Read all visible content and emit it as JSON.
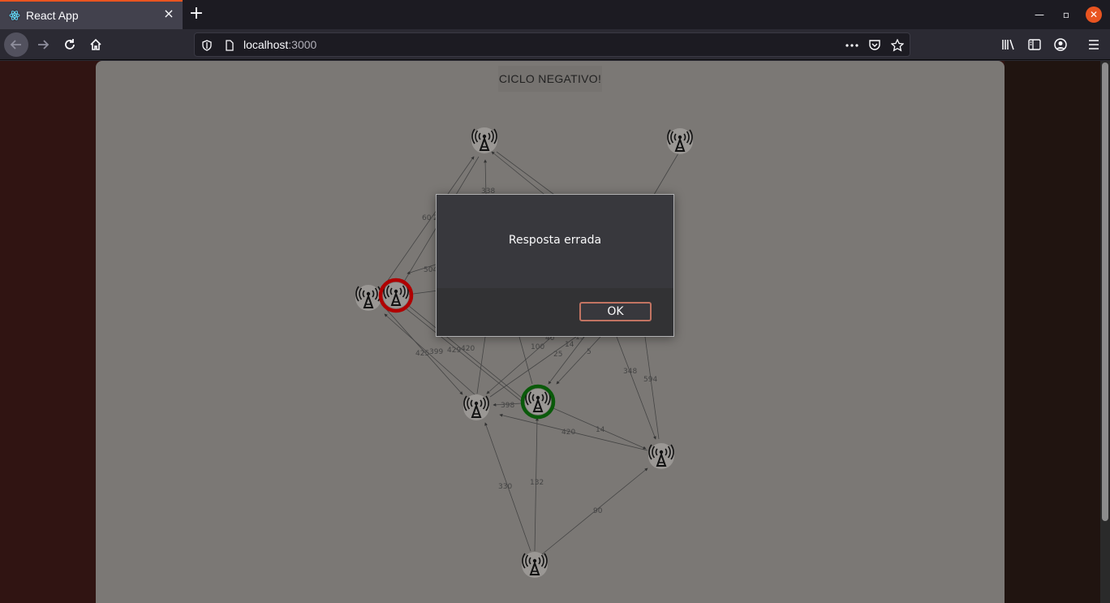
{
  "browser": {
    "tab_title": "React App",
    "tab_close": "×",
    "new_tab": "+",
    "url_host": "localhost",
    "url_port": ":3000",
    "accent": "#e95420"
  },
  "page": {
    "title": "CICLO NEGATIVO!"
  },
  "graph": {
    "edge_labels": [
      "338",
      "60",
      "504",
      "399",
      "425",
      "429",
      "420",
      "100",
      "25",
      "14",
      "5",
      "348",
      "594",
      "398",
      "420",
      "14",
      "330",
      "132",
      "90",
      "40",
      "15",
      "2"
    ],
    "node_icon": "antenna-tower-icon",
    "highlight_colors": {
      "source": "#b00000",
      "target": "#0a5a0a"
    }
  },
  "dialog": {
    "message": "Resposta errada",
    "ok_label": "OK"
  }
}
